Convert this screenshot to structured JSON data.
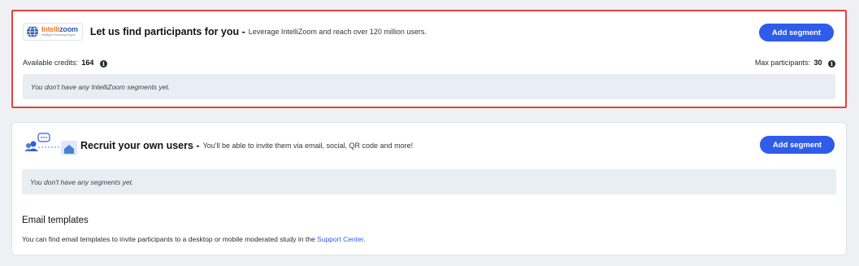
{
  "intellizoom": {
    "logo_name_part1": "Intelli",
    "logo_name_part2": "zoom",
    "logo_tagline": "Intelligent Sourcing Engine",
    "title": "Let us find participants for you -",
    "subtitle": "Leverage IntelliZoom and reach over 120 million users.",
    "add_button": "Add segment",
    "credits_label": "Available credits:",
    "credits_value": "164",
    "max_label": "Max participants:",
    "max_value": "30",
    "empty_text": "You don't have any IntelliZoom segments yet."
  },
  "recruit": {
    "title": "Recruit your own users -",
    "subtitle": "You'll be able to invite them via email, social, QR code and more!",
    "add_button": "Add segment",
    "empty_text": "You don't have any segments yet.",
    "email_title": "Email templates",
    "email_desc_prefix": "You can find email templates to invite participants to a desktop or mobile moderated study in the",
    "email_link": "Support Center",
    "email_desc_suffix": "."
  },
  "icons": {
    "globe": "globe-icon",
    "info": "info-icon",
    "recruit": "recruit-users-icon"
  },
  "colors": {
    "accent": "#2f5ce8",
    "highlight_border": "#e8403b",
    "empty_bg": "#e9edf4"
  }
}
